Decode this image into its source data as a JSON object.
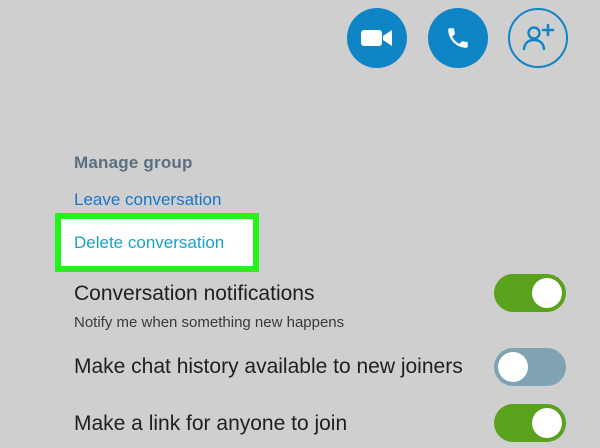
{
  "header": {
    "buttons": [
      {
        "icon": "video-camera-icon"
      },
      {
        "icon": "phone-icon"
      },
      {
        "icon": "add-person-icon"
      }
    ],
    "accent_color": "#0f85c6"
  },
  "manage_group": {
    "title": "Manage group",
    "leave_label": "Leave conversation",
    "delete_label": "Delete conversation",
    "highlight_color": "#23f51a"
  },
  "settings": {
    "notifications": {
      "label": "Conversation notifications",
      "description": "Notify me when something new happens",
      "enabled": true
    },
    "chat_history": {
      "label": "Make chat history available to new joiners",
      "enabled": false
    },
    "join_link": {
      "label": "Make a link for anyone to join",
      "enabled": true
    },
    "toggle_on_color": "#5aa21b",
    "toggle_off_color": "#7fa3b3"
  }
}
